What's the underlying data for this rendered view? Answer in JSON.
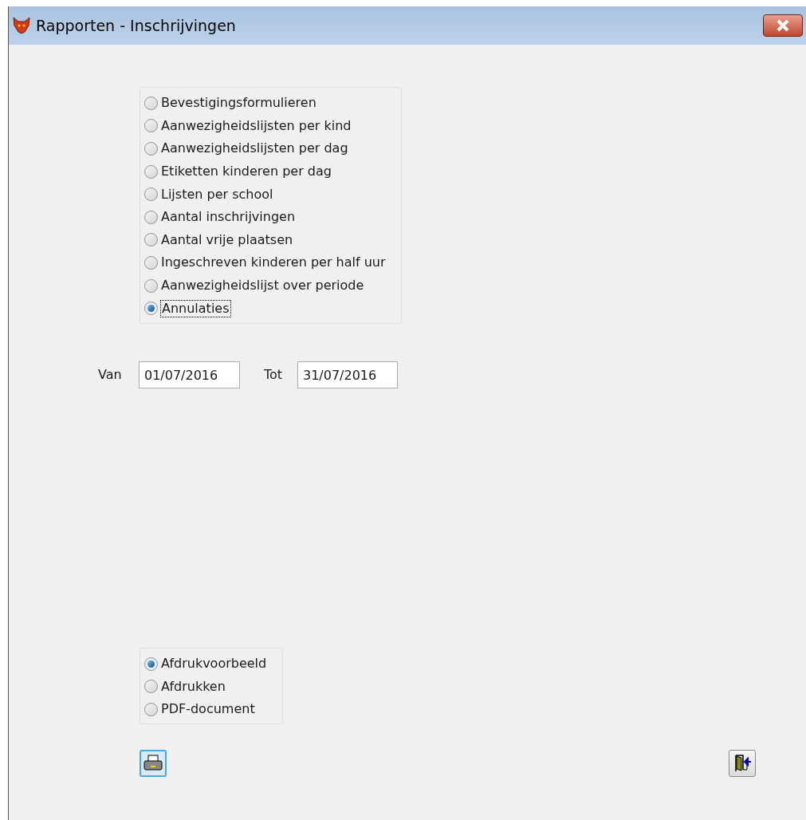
{
  "window": {
    "title": "Rapporten - Inschrijvingen"
  },
  "reports": [
    {
      "label": "Bevestigingsformulieren",
      "selected": false
    },
    {
      "label": "Aanwezigheidslijsten per kind",
      "selected": false
    },
    {
      "label": "Aanwezigheidslijsten per dag",
      "selected": false
    },
    {
      "label": "Etiketten kinderen per dag",
      "selected": false
    },
    {
      "label": "Lijsten per school",
      "selected": false
    },
    {
      "label": "Aantal inschrijvingen",
      "selected": false
    },
    {
      "label": "Aantal vrije plaatsen",
      "selected": false
    },
    {
      "label": "Ingeschreven kinderen per half uur",
      "selected": false
    },
    {
      "label": "Aanwezigheidslijst over periode",
      "selected": false
    },
    {
      "label": "Annulaties",
      "selected": true
    }
  ],
  "period": {
    "from_label": "Van",
    "from_value": "01/07/2016",
    "to_label": "Tot",
    "to_value": "31/07/2016"
  },
  "output": [
    {
      "label": "Afdrukvoorbeeld",
      "selected": true
    },
    {
      "label": "Afdrukken",
      "selected": false
    },
    {
      "label": "PDF-document",
      "selected": false
    }
  ]
}
